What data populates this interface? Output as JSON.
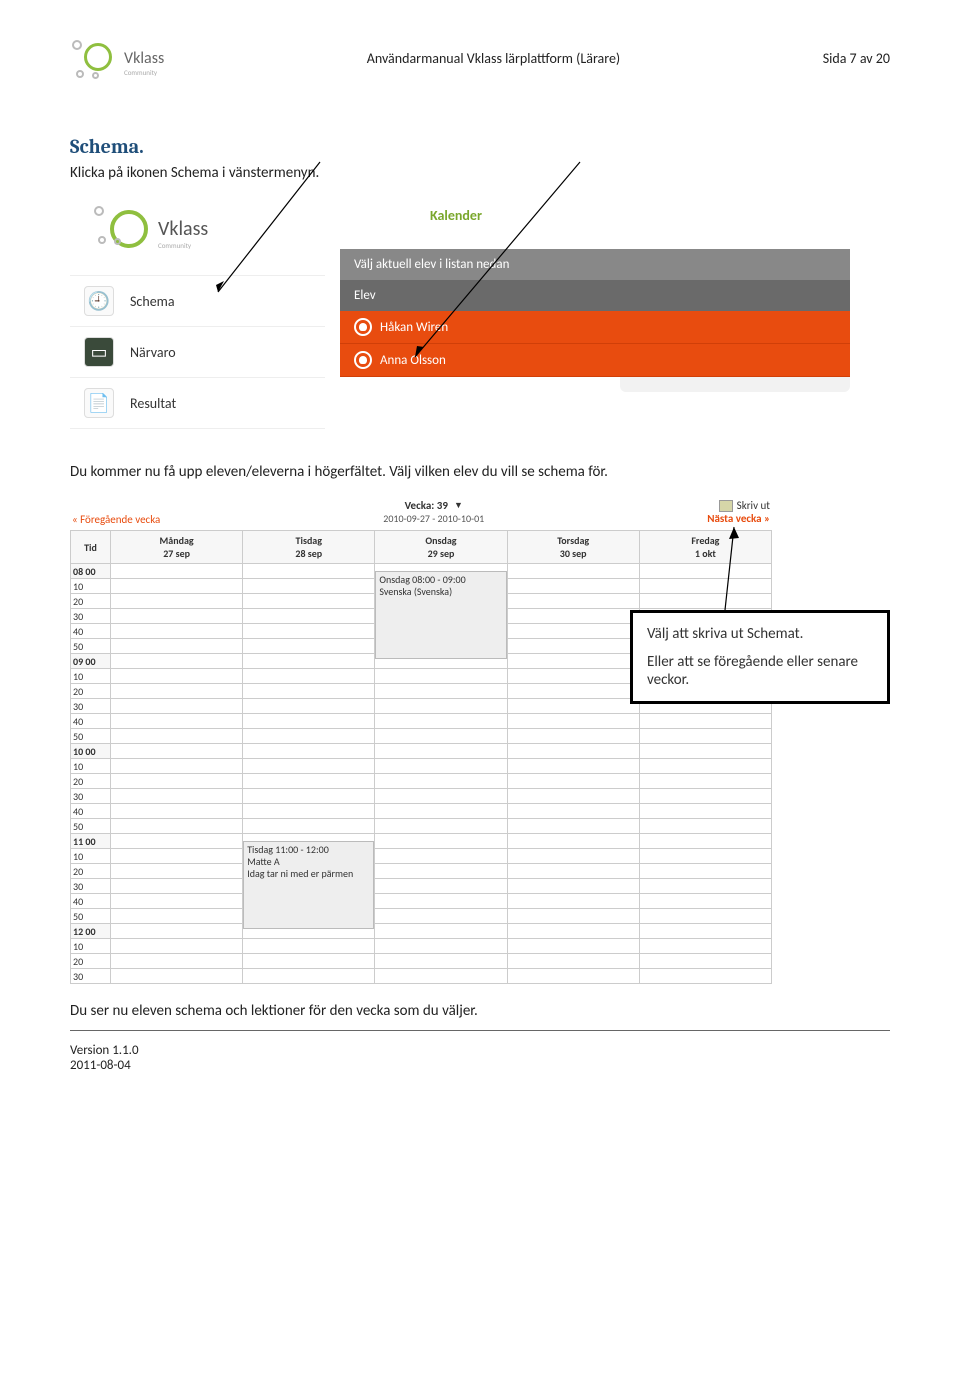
{
  "header": {
    "logo_text": "Vklass",
    "logo_sub": "Community",
    "doc_title": "Användarmanual Vklass lärplattform (Lärare)",
    "page_num": "Sida 7 av 20"
  },
  "body": {
    "heading": "Schema.",
    "intro": "Klicka på ikonen Schema i vänstermenyn.",
    "mid_text": "Du kommer nu få upp eleven/eleverna i högerfältet. Välj vilken elev du vill se schema för.",
    "bottom_text": "Du ser nu eleven schema och lektioner för den vecka som du väljer."
  },
  "ss1": {
    "logo_text": "Vklass",
    "logo_sub": "Community",
    "menu": [
      {
        "label": "Schema",
        "icon": "clock"
      },
      {
        "label": "Närvaro",
        "icon": "board"
      },
      {
        "label": "Resultat",
        "icon": "doc"
      }
    ],
    "kalender": "Kalender",
    "grey_text": "Välj aktuell elev i listan nedan",
    "darkgrey_text": "Elev",
    "elev1": "Håkan Wiren",
    "elev2": "Anna Olsson"
  },
  "ss2": {
    "prev": "« Föregående vecka",
    "week_title": "Vecka: 39",
    "week_range": "2010-09-27 - 2010-10-01",
    "print": "Skriv ut",
    "next": "Nästa vecka »",
    "cols": [
      {
        "day": "Måndag",
        "date": "27 sep"
      },
      {
        "day": "Tisdag",
        "date": "28 sep"
      },
      {
        "day": "Onsdag",
        "date": "29 sep"
      },
      {
        "day": "Torsdag",
        "date": "30 sep"
      },
      {
        "day": "Fredag",
        "date": "1 okt"
      }
    ],
    "tid": "Tid",
    "hours": [
      "08",
      "09",
      "10",
      "11",
      "12"
    ],
    "minutes": [
      "00",
      "10",
      "20",
      "30",
      "40",
      "50"
    ],
    "lesson1": {
      "time": "Onsdag 08:00 - 09:00",
      "subj": "Svenska (Svenska)"
    },
    "lesson2": {
      "time": "Tisdag 11:00 - 12:00",
      "subj": "Matte A",
      "note": "Idag tar ni med er pärmen"
    }
  },
  "callout": {
    "line1": "Välj att skriva ut Schemat.",
    "line2": "Eller att se föregående eller senare veckor."
  },
  "footer": {
    "version": "Version 1.1.0",
    "date": "2011-08-04"
  }
}
